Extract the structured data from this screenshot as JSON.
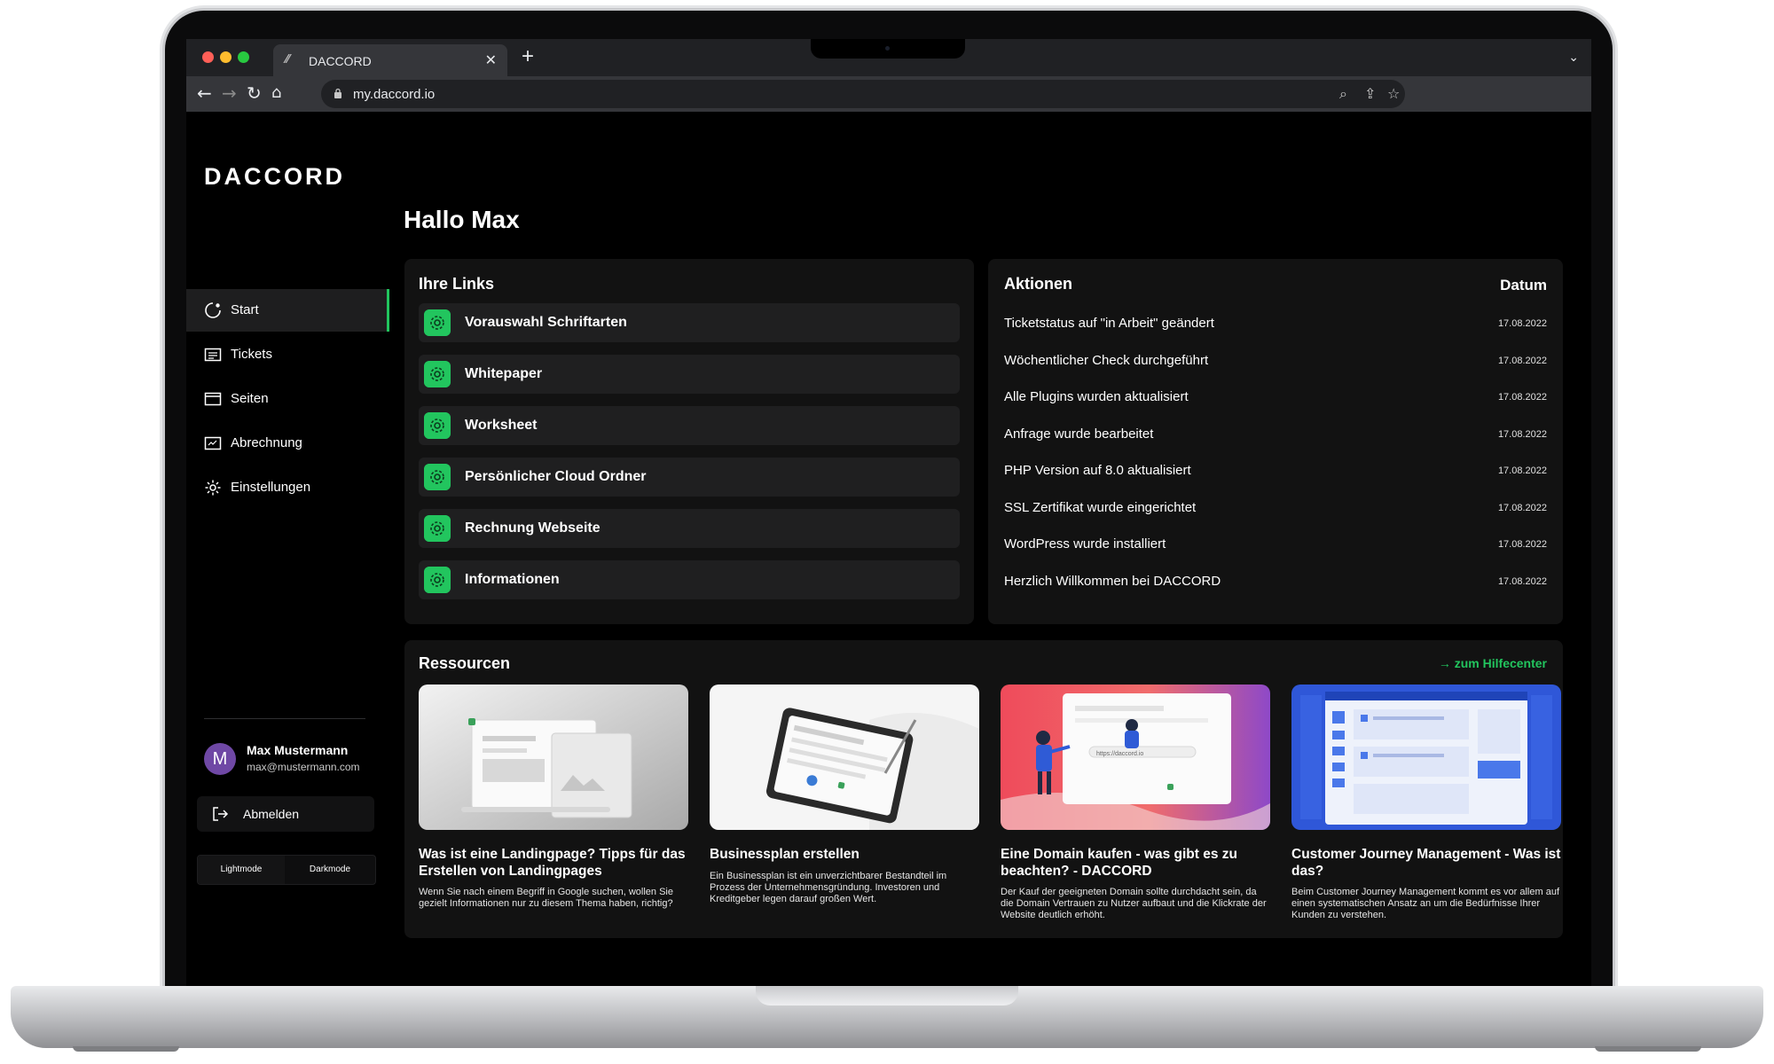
{
  "browser": {
    "tab_title": "DACCORD",
    "url": "my.daccord.io"
  },
  "app": {
    "logo": "DACCORD",
    "sidebar": {
      "items": [
        {
          "label": "Start",
          "icon": "start-icon",
          "active": true
        },
        {
          "label": "Tickets",
          "icon": "tickets-icon",
          "active": false
        },
        {
          "label": "Seiten",
          "icon": "pages-icon",
          "active": false
        },
        {
          "label": "Abrechnung",
          "icon": "billing-icon",
          "active": false
        },
        {
          "label": "Einstellungen",
          "icon": "gear-icon",
          "active": false
        }
      ]
    },
    "user": {
      "initial": "M",
      "name": "Max Mustermann",
      "email": "max@mustermann.com"
    },
    "logout_label": "Abmelden",
    "modes": {
      "light": "Lightmode",
      "dark": "Darkmode"
    }
  },
  "main": {
    "greeting": "Hallo Max",
    "links": {
      "title": "Ihre Links",
      "items": [
        "Vorauswahl Schriftarten",
        "Whitepaper",
        "Worksheet",
        "Persönlicher Cloud Ordner",
        "Rechnung Webseite",
        "Informationen"
      ]
    },
    "actions": {
      "title": "Aktionen",
      "date_header": "Datum",
      "items": [
        {
          "text": "Ticketstatus auf \"in Arbeit\" geändert",
          "date": "17.08.2022"
        },
        {
          "text": "Wöchentlicher Check durchgeführt",
          "date": "17.08.2022"
        },
        {
          "text": "Alle Plugins wurden aktualisiert",
          "date": "17.08.2022"
        },
        {
          "text": "Anfrage wurde bearbeitet",
          "date": "17.08.2022"
        },
        {
          "text": "PHP Version auf 8.0 aktualisiert",
          "date": "17.08.2022"
        },
        {
          "text": "SSL Zertifikat wurde eingerichtet",
          "date": "17.08.2022"
        },
        {
          "text": "WordPress wurde installiert",
          "date": "17.08.2022"
        },
        {
          "text": "Herzlich Willkommen bei DACCORD",
          "date": "17.08.2022"
        }
      ]
    },
    "resources": {
      "title": "Ressourcen",
      "help_link": "→ zum Hilfecenter",
      "items": [
        {
          "title": "Was ist eine Landingpage? Tipps für das Erstellen von Landingpages",
          "desc": "Wenn Sie nach einem Begriff in Google suchen, wollen Sie gezielt Informationen nur zu diesem Thema haben, richtig?"
        },
        {
          "title": "Businessplan erstellen",
          "desc": "Ein Businessplan ist ein unverzichtbarer Bestandteil im Prozess der Unternehmensgründung. Investoren und Kreditgeber legen darauf großen Wert."
        },
        {
          "title": "Eine Domain kaufen - was gibt es zu beachten? - DACCORD",
          "desc": "Der Kauf der geeigneten Domain sollte durchdacht sein, da die Domain Vertrauen zu Nutzer aufbaut und die Klickrate der Website deutlich erhöht.",
          "thumb_text": "https://daccord.io"
        },
        {
          "title": "Customer Journey Management - Was ist das?",
          "desc": "Beim Customer Journey Management kommt es vor allem auf einen systematischen Ansatz an um die Bedürfnisse Ihrer Kunden zu verstehen."
        }
      ]
    }
  },
  "colors": {
    "accent": "#22c55e",
    "background": "#000000",
    "card": "#121212",
    "avatar": "#6f48a5"
  }
}
